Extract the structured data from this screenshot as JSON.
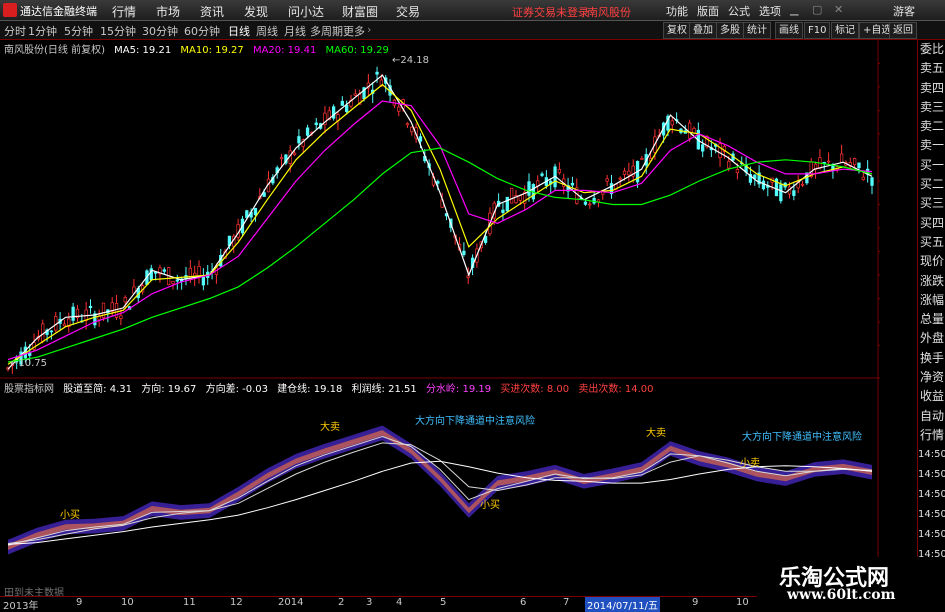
{
  "menubar": {
    "app_title": "通达信金融终端",
    "menus": [
      "行情",
      "市场",
      "资讯",
      "发现",
      "问小达",
      "财富圈",
      "交易"
    ],
    "notice": "证券交易未登录",
    "stock_name": "南风股份",
    "right_items": [
      "功能",
      "版面",
      "公式",
      "选项"
    ],
    "guest": "游客"
  },
  "periodbar": {
    "periods": [
      "分时",
      "1分钟",
      "5分钟",
      "15分钟",
      "30分钟",
      "60分钟",
      "日线",
      "周线",
      "月线",
      "多周期",
      "更多"
    ],
    "active": "日线",
    "buttons": [
      "复权",
      "叠加",
      "多股",
      "统计",
      "画线",
      "F10",
      "标记",
      "+自选",
      "返回"
    ]
  },
  "legend_main": {
    "title": "南风股份(日线 前复权)",
    "ma5": "MA5: 19.21",
    "ma10": "MA10: 19.27",
    "ma20": "MA20: 19.41",
    "ma60": "MA60: 19.29",
    "colors": {
      "ma5": "#ffffff",
      "ma10": "#ffff00",
      "ma20": "#ff00ff",
      "ma60": "#00ff00"
    }
  },
  "legend_sub": {
    "title": "股票指标网",
    "items": [
      {
        "text": "股道至简: 4.31",
        "color": "#ffffff"
      },
      {
        "text": "方向: 19.67",
        "color": "#ffffff"
      },
      {
        "text": "方向差: -0.03",
        "color": "#ffffff"
      },
      {
        "text": "建仓线: 19.18",
        "color": "#ffffff"
      },
      {
        "text": "利润线: 21.51",
        "color": "#ffffff"
      },
      {
        "text": "分水岭: 19.19",
        "color": "#ff40ff"
      },
      {
        "text": "买进次数: 8.00",
        "color": "#ff4040"
      },
      {
        "text": "卖出次数: 14.00",
        "color": "#ff4040"
      }
    ]
  },
  "chart_data": {
    "type": "line",
    "title": "南风股份(日线 前复权)",
    "y_axis_ticks": [
      12.0,
      13.0,
      14.0,
      15.0,
      16.0,
      17.0,
      18.0,
      19.0,
      20.0,
      21.0,
      22.0,
      23.0,
      24.0
    ],
    "ylim": [
      11.3,
      24.4
    ],
    "annotations": [
      {
        "label": "24.18",
        "type": "high"
      },
      {
        "label": "10.75",
        "type": "low"
      }
    ],
    "series": [
      {
        "name": "MA5",
        "color": "#ffffff",
        "values": [
          11.0,
          12.3,
          13.2,
          13.3,
          13.6,
          15.2,
          14.8,
          15.0,
          16.8,
          18.8,
          20.4,
          21.5,
          22.5,
          23.5,
          21.5,
          18.5,
          15.0,
          18.0,
          18.5,
          19.2,
          18.2,
          18.8,
          19.5,
          21.8,
          20.7,
          20.0,
          19.0,
          18.5,
          19.5,
          19.8,
          19.2
        ]
      },
      {
        "name": "MA10",
        "color": "#ffff00",
        "values": [
          11.2,
          12.0,
          12.8,
          13.2,
          13.5,
          14.8,
          14.9,
          15.0,
          16.4,
          18.2,
          19.9,
          21.1,
          22.1,
          23.1,
          22.0,
          19.5,
          16.2,
          17.4,
          18.2,
          19.0,
          18.5,
          18.6,
          19.2,
          21.2,
          21.0,
          20.2,
          19.3,
          18.8,
          19.3,
          19.6,
          19.3
        ]
      },
      {
        "name": "MA20",
        "color": "#ff00ff",
        "values": [
          11.4,
          11.8,
          12.4,
          13.0,
          13.4,
          14.2,
          14.7,
          15.0,
          15.8,
          17.4,
          19.0,
          20.3,
          21.4,
          22.4,
          22.2,
          20.5,
          17.6,
          17.2,
          17.8,
          18.6,
          18.6,
          18.5,
          18.9,
          20.3,
          21.0,
          20.5,
          19.8,
          19.3,
          19.3,
          19.5,
          19.4
        ]
      },
      {
        "name": "MA60",
        "color": "#00ff00",
        "values": [
          11.3,
          11.5,
          11.9,
          12.3,
          12.7,
          13.2,
          13.6,
          14.0,
          14.5,
          15.3,
          16.2,
          17.2,
          18.2,
          19.3,
          20.2,
          20.4,
          19.8,
          19.1,
          18.6,
          18.3,
          18.2,
          18.0,
          18.0,
          18.4,
          19.0,
          19.5,
          19.8,
          19.9,
          19.8,
          19.6,
          19.3
        ]
      }
    ]
  },
  "sub_chart": {
    "y_axis_ticks": [
      15.0,
      20.0,
      25.0
    ],
    "annotations": [
      "大方向下降通道中注意风险",
      "大方向下降通道中注意风险"
    ],
    "markers": [
      "小买",
      "小买",
      "大卖",
      "大卖",
      "小卖"
    ]
  },
  "right_panel": [
    "委比",
    "卖五",
    "卖四",
    "卖三",
    "卖二",
    "卖一",
    "买一",
    "买二",
    "买三",
    "买四",
    "买五",
    "现价",
    "涨跌",
    "涨幅",
    "总量",
    "外盘",
    "换手",
    "净资",
    "收益",
    "自动",
    "行情",
    "14:50",
    "14:50",
    "14:50",
    "14:50",
    "14:50",
    "14:50",
    "14:50"
  ],
  "date_axis": {
    "labels": [
      "2013年",
      "9",
      "10",
      "11",
      "12",
      "2014",
      "2",
      "3",
      "4",
      "5",
      "6",
      "7",
      "8",
      "9",
      "10"
    ],
    "selected": "2014/07/11/五"
  },
  "status_note": "田到未主数据",
  "watermark": {
    "line1": "乐淘公式网",
    "line2": "www.60lt.com"
  }
}
